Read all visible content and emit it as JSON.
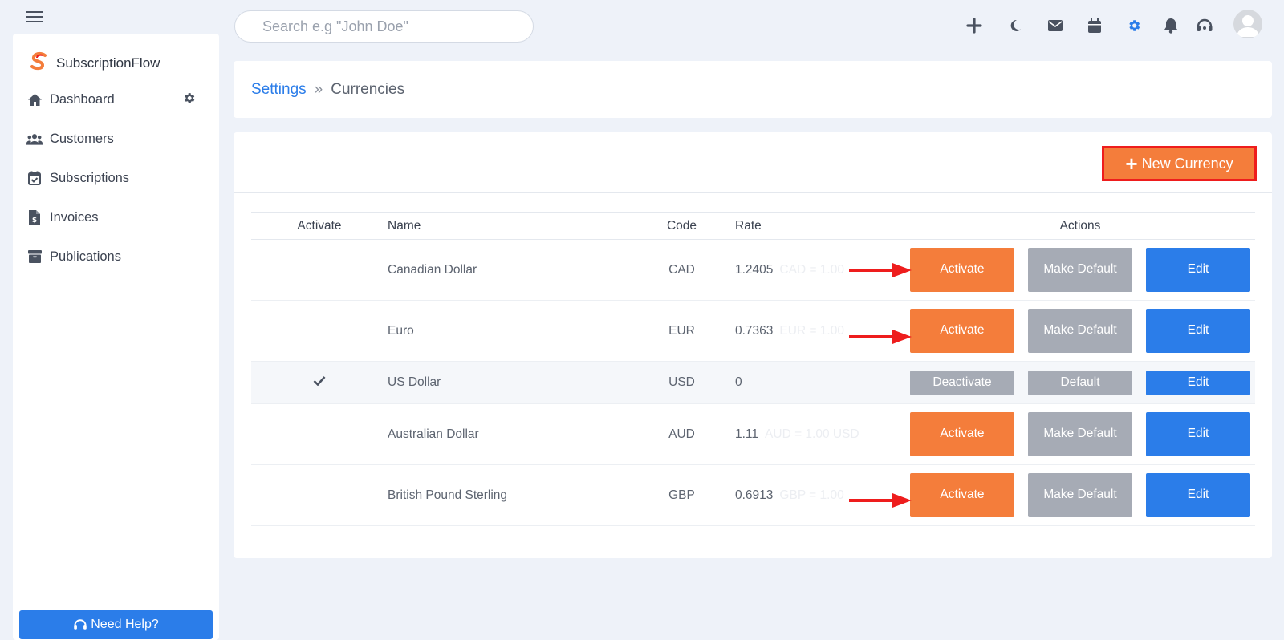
{
  "search": {
    "placeholder": "Search e.g \"John Doe\""
  },
  "topbar": {
    "icons": [
      "plus-icon",
      "moon-icon",
      "mail-icon",
      "calendar-icon",
      "gear-icon",
      "bell-icon",
      "headset-icon"
    ],
    "accent": "#2b7de9"
  },
  "sidebar": {
    "brand": "SubscriptionFlow",
    "items": [
      {
        "label": "Dashboard",
        "icon": "home-icon"
      },
      {
        "label": "Customers",
        "icon": "users-icon"
      },
      {
        "label": "Subscriptions",
        "icon": "calendar-check-icon"
      },
      {
        "label": "Invoices",
        "icon": "invoice-icon"
      },
      {
        "label": "Publications",
        "icon": "archive-icon"
      }
    ],
    "help": "Need Help?"
  },
  "breadcrumb": {
    "parent": "Settings",
    "separator": "»",
    "current": "Currencies"
  },
  "toolbar": {
    "new_currency": "New Currency"
  },
  "table": {
    "headers": {
      "activate": "Activate",
      "name": "Name",
      "code": "Code",
      "rate": "Rate",
      "actions": "Actions"
    },
    "rows": [
      {
        "name": "Canadian Dollar",
        "code": "CAD",
        "rate": "1.2405",
        "ghost": "CAD = 1.00",
        "primary": "Activate",
        "secondary": "Make Default",
        "edit": "Edit"
      },
      {
        "name": "Euro",
        "code": "EUR",
        "rate": "0.7363",
        "ghost": "EUR = 1.00",
        "primary": "Activate",
        "secondary": "Make Default",
        "edit": "Edit"
      },
      {
        "name": "US Dollar",
        "code": "USD",
        "rate": "0",
        "ghost": "",
        "primary": "Deactivate",
        "secondary": "Default",
        "edit": "Edit"
      },
      {
        "name": "Australian Dollar",
        "code": "AUD",
        "rate": "1.11",
        "ghost": "AUD = 1.00 USD",
        "primary": "Activate",
        "secondary": "Make Default",
        "edit": "Edit"
      },
      {
        "name": "British Pound Sterling",
        "code": "GBP",
        "rate": "0.6913",
        "ghost": "GBP = 1.00",
        "primary": "Activate",
        "secondary": "Make Default",
        "edit": "Edit"
      }
    ]
  },
  "colors": {
    "orange": "#f47d3b",
    "grey": "#a6abb5",
    "blue": "#2b7de9",
    "highlight": "#ee1d1d"
  }
}
